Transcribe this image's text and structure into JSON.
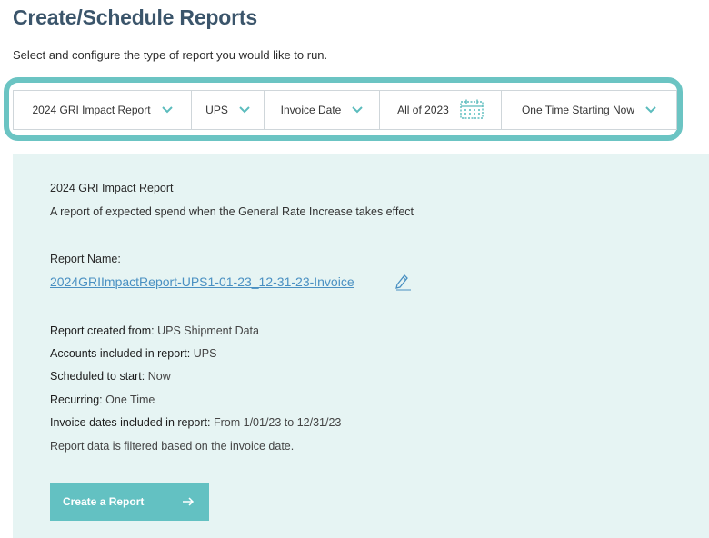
{
  "page": {
    "title": "Create/Schedule Reports",
    "subtitle": "Select and configure the type of report you would like to run."
  },
  "filters": {
    "report_type": "2024 GRI Impact Report",
    "carrier": "UPS",
    "date_type": "Invoice Date",
    "date_range": "All of 2023",
    "schedule": "One Time Starting Now"
  },
  "details": {
    "report_title": "2024 GRI Impact Report",
    "description": "A report of expected spend when the General Rate Increase takes effect",
    "report_name_label": "Report Name:",
    "report_name_value": "2024GRIImpactReport-UPS1-01-23_12-31-23-Invoice",
    "created_from_label": "Report created from:",
    "created_from_value": "UPS Shipment Data",
    "accounts_label": "Accounts included in report:",
    "accounts_value": "UPS",
    "scheduled_label": "Scheduled to start:",
    "scheduled_value": "Now",
    "recurring_label": "Recurring:",
    "recurring_value": "One Time",
    "invoice_dates_label": "Invoice dates included in report:",
    "invoice_dates_value": "From 1/01/23 to 12/31/23",
    "filter_note": "Report data is filtered based on the invoice date."
  },
  "actions": {
    "create_label": "Create a Report"
  },
  "colors": {
    "accent": "#63c1c2",
    "highlight_frame": "#6bc4c3",
    "panel_bg": "#e6f4f3",
    "title": "#3b556b",
    "link": "#4a90c2"
  },
  "icons": {
    "dropdown": "chevron-down-icon",
    "calendar": "calendar-icon",
    "edit": "pencil-icon",
    "submit": "arrow-right-icon"
  }
}
